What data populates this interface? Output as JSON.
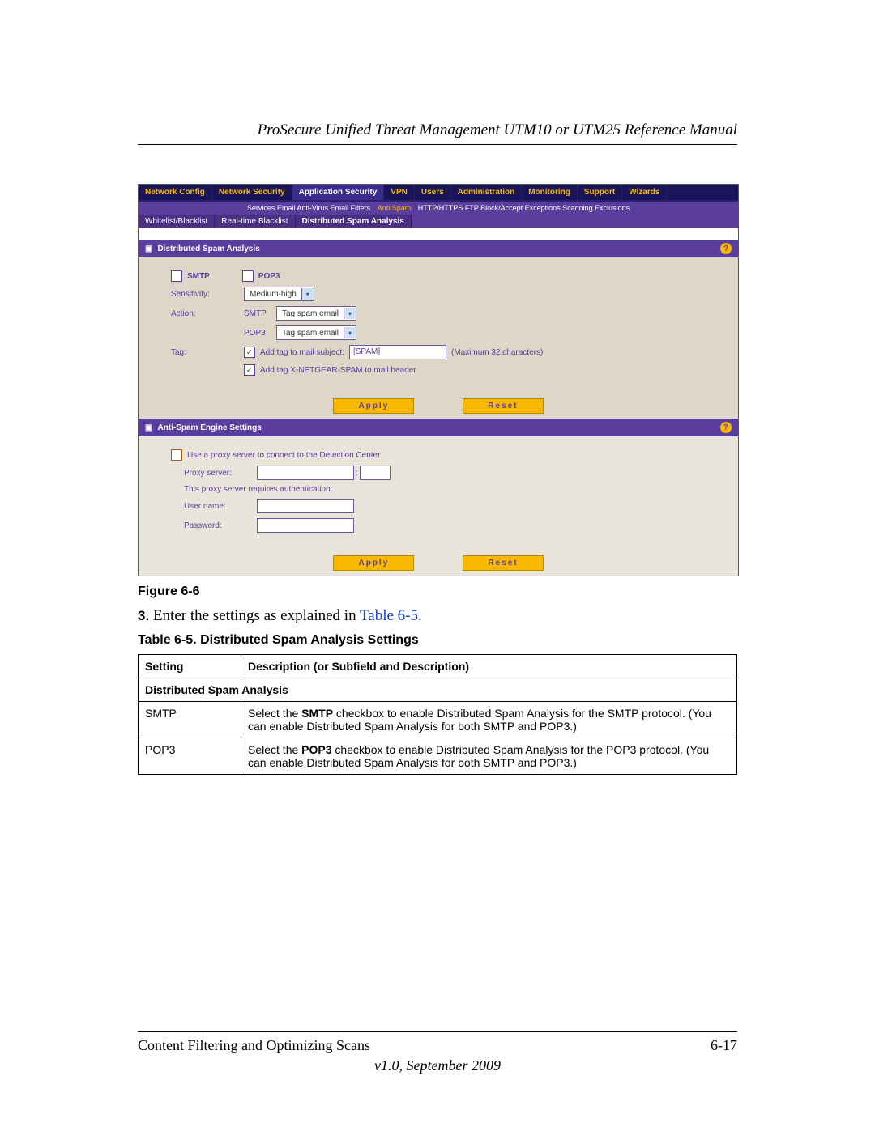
{
  "header": {
    "title": "ProSecure Unified Threat Management UTM10 or UTM25 Reference Manual"
  },
  "screenshot": {
    "topnav": [
      "Network Config",
      "Network Security",
      "Application Security",
      "VPN",
      "Users",
      "Administration",
      "Monitoring",
      "Support",
      "Wizards"
    ],
    "topnav_active": 2,
    "subnav_left": "Services  Email Anti-Virus  Email Filters",
    "subnav_active": "Anti Spam",
    "subnav_right": "HTTP/HTTPS  FTP  Block/Accept Exceptions  Scanning Exclusions",
    "subtabs": [
      "Whitelist/Blacklist",
      "Real-time Blacklist",
      "Distributed Spam Analysis"
    ],
    "subtabs_active": 2,
    "sec1": {
      "title": "Distributed Spam Analysis",
      "smtp": "SMTP",
      "pop3": "POP3",
      "sensitivity_lbl": "Sensitivity:",
      "sensitivity_val": "Medium-high",
      "action_lbl": "Action:",
      "action_smtp_lbl": "SMTP",
      "action_smtp_val": "Tag spam email",
      "action_pop3_lbl": "POP3",
      "action_pop3_val": "Tag spam email",
      "tag_lbl": "Tag:",
      "tag_subject_lbl": "Add tag to mail subject:",
      "tag_subject_val": "[SPAM]",
      "tag_subject_hint": "(Maximum 32 characters)",
      "tag_header_lbl": "Add tag X-NETGEAR-SPAM to mail header"
    },
    "apply": "Apply",
    "reset": "Reset",
    "sec2": {
      "title": "Anti-Spam Engine Settings",
      "proxy_enable": "Use a proxy server to connect to the Detection Center",
      "proxy_lbl": "Proxy server:",
      "proxy_auth": "This proxy server requires authentication:",
      "user_lbl": "User name:",
      "pass_lbl": "Password:"
    }
  },
  "figure_caption": "Figure 6-6",
  "step3_num": "3.",
  "step3_text": "Enter the settings as explained in ",
  "step3_link": "Table 6-5",
  "step3_end": ".",
  "table_caption": "Table 6-5. Distributed Spam Analysis Settings",
  "table": {
    "h1": "Setting",
    "h2": "Description (or Subfield and Description)",
    "section": "Distributed Spam Analysis",
    "r1c1": "SMTP",
    "r1c2a": "Select the ",
    "r1c2b": "SMTP",
    "r1c2c": " checkbox to enable Distributed Spam Analysis for the SMTP protocol. (You can enable Distributed Spam Analysis for both SMTP and POP3.)",
    "r2c1": "POP3",
    "r2c2a": "Select the ",
    "r2c2b": "POP3",
    "r2c2c": " checkbox to enable Distributed Spam Analysis for the POP3 protocol. (You can enable Distributed Spam Analysis for both SMTP and POP3.)"
  },
  "footer": {
    "left": "Content Filtering and Optimizing Scans",
    "right": "6-17",
    "version": "v1.0, September 2009"
  }
}
